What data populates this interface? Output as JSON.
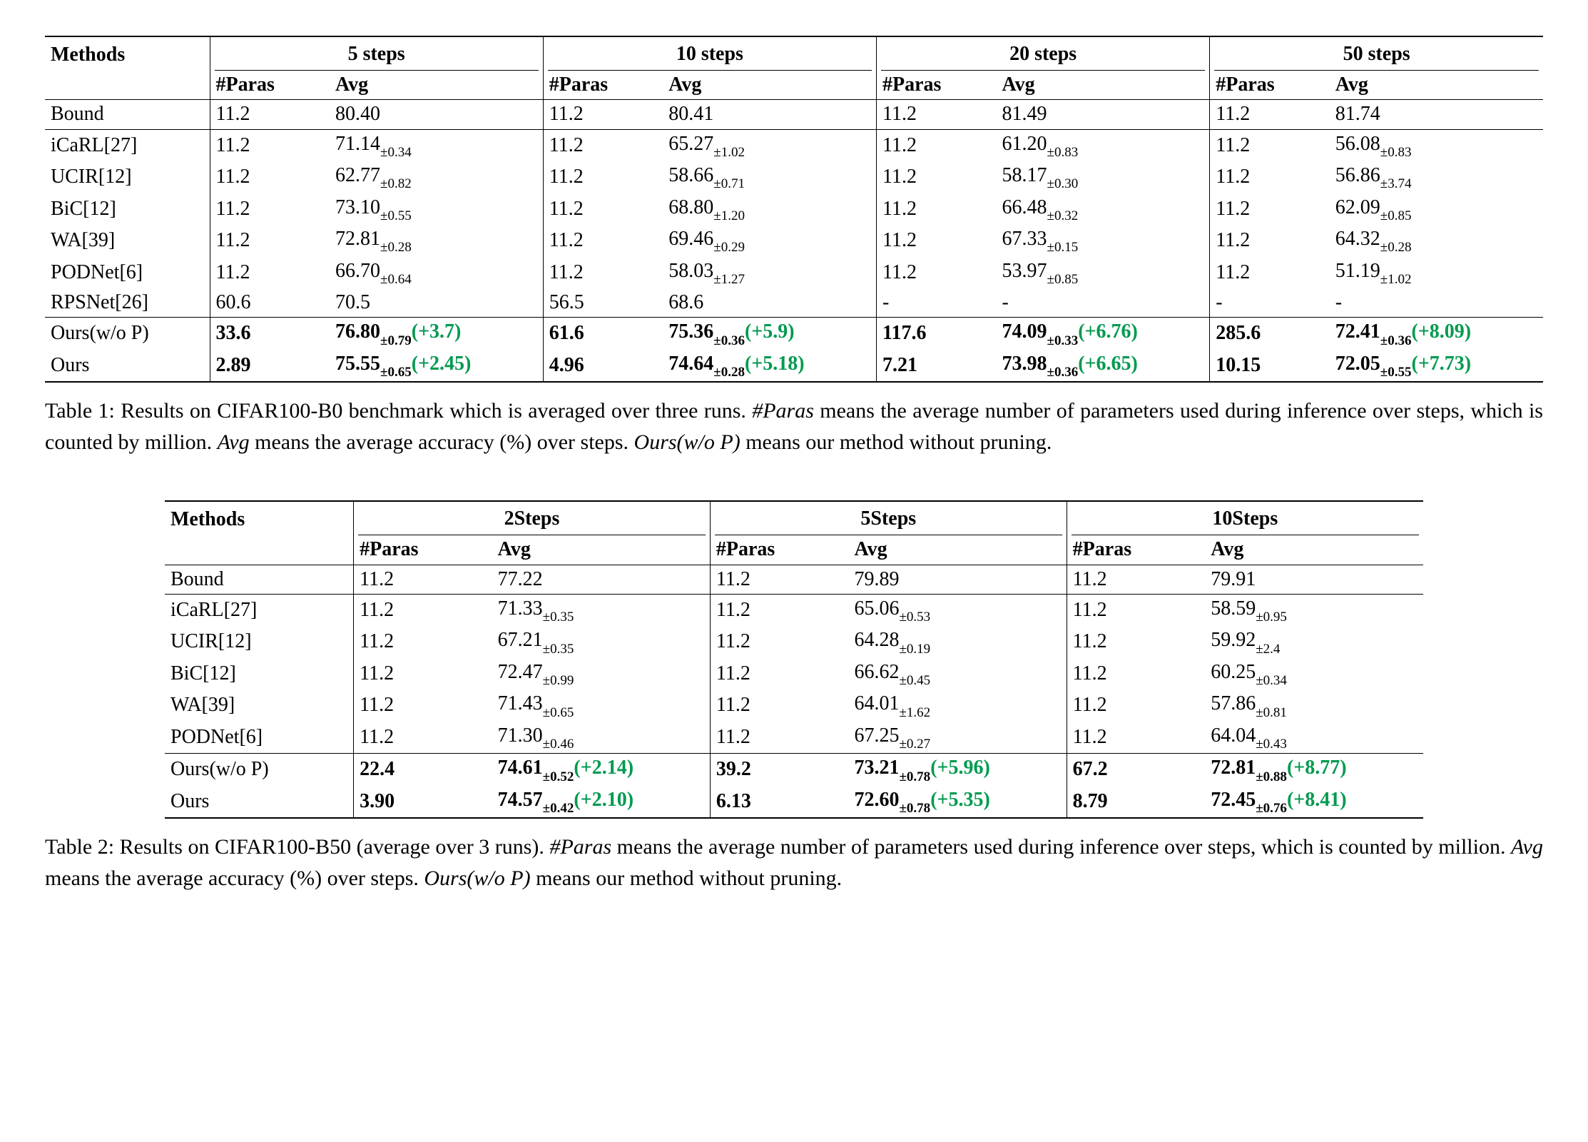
{
  "table1": {
    "headers": {
      "methods": "Methods",
      "steps": [
        "5 steps",
        "10 steps",
        "20 steps",
        "50 steps"
      ],
      "paras": "#Paras",
      "avg": "Avg"
    },
    "caption_prefix": "Table 1: Results on CIFAR100-B0 benchmark which is averaged over three runs. ",
    "caption_paras_label": "#Paras",
    "caption_mid1": " means the average number of parameters used during inference over steps, which is counted by million. ",
    "caption_avg_label": "Avg",
    "caption_mid2": " means the average accuracy (%) over steps. ",
    "caption_ours_label": "Ours(w/o P)",
    "caption_tail": " means our method without pruning.",
    "sections": [
      {
        "rows": [
          {
            "name": "Bound",
            "cells": [
              {
                "paras": "11.2",
                "avg": "80.40"
              },
              {
                "paras": "11.2",
                "avg": "80.41"
              },
              {
                "paras": "11.2",
                "avg": "81.49"
              },
              {
                "paras": "11.2",
                "avg": "81.74"
              }
            ]
          }
        ]
      },
      {
        "rows": [
          {
            "name": "iCaRL[27]",
            "cells": [
              {
                "paras": "11.2",
                "avg": "71.14",
                "pm": "±0.34"
              },
              {
                "paras": "11.2",
                "avg": "65.27",
                "pm": "±1.02"
              },
              {
                "paras": "11.2",
                "avg": "61.20",
                "pm": "±0.83"
              },
              {
                "paras": "11.2",
                "avg": "56.08",
                "pm": "±0.83"
              }
            ]
          },
          {
            "name": "UCIR[12]",
            "cells": [
              {
                "paras": "11.2",
                "avg": "62.77",
                "pm": "±0.82"
              },
              {
                "paras": "11.2",
                "avg": "58.66",
                "pm": "±0.71"
              },
              {
                "paras": "11.2",
                "avg": "58.17",
                "pm": "±0.30"
              },
              {
                "paras": "11.2",
                "avg": "56.86",
                "pm": "±3.74"
              }
            ]
          },
          {
            "name": "BiC[12]",
            "cells": [
              {
                "paras": "11.2",
                "avg": "73.10",
                "pm": "±0.55"
              },
              {
                "paras": "11.2",
                "avg": "68.80",
                "pm": "±1.20"
              },
              {
                "paras": "11.2",
                "avg": "66.48",
                "pm": "±0.32"
              },
              {
                "paras": "11.2",
                "avg": "62.09",
                "pm": "±0.85"
              }
            ]
          },
          {
            "name": "WA[39]",
            "cells": [
              {
                "paras": "11.2",
                "avg": "72.81",
                "pm": "±0.28"
              },
              {
                "paras": "11.2",
                "avg": "69.46",
                "pm": "±0.29"
              },
              {
                "paras": "11.2",
                "avg": "67.33",
                "pm": "±0.15"
              },
              {
                "paras": "11.2",
                "avg": "64.32",
                "pm": "±0.28"
              }
            ]
          },
          {
            "name": "PODNet[6]",
            "cells": [
              {
                "paras": "11.2",
                "avg": "66.70",
                "pm": "±0.64"
              },
              {
                "paras": "11.2",
                "avg": "58.03",
                "pm": "±1.27"
              },
              {
                "paras": "11.2",
                "avg": "53.97",
                "pm": "±0.85"
              },
              {
                "paras": "11.2",
                "avg": "51.19",
                "pm": "±1.02"
              }
            ]
          },
          {
            "name": "RPSNet[26]",
            "cells": [
              {
                "paras": "60.6",
                "avg": "70.5"
              },
              {
                "paras": "56.5",
                "avg": "68.6"
              },
              {
                "paras": "-",
                "avg": "-"
              },
              {
                "paras": "-",
                "avg": "-"
              }
            ]
          }
        ]
      },
      {
        "rows": [
          {
            "name": "Ours(w/o P)",
            "bold": true,
            "cells": [
              {
                "paras": "33.6",
                "avg": "76.80",
                "pm": "±0.79",
                "delta": "(+3.7)"
              },
              {
                "paras": "61.6",
                "avg": "75.36",
                "pm": "±0.36",
                "delta": "(+5.9)"
              },
              {
                "paras": "117.6",
                "avg": "74.09",
                "pm": "±0.33",
                "delta": "(+6.76)"
              },
              {
                "paras": "285.6",
                "avg": "72.41",
                "pm": "±0.36",
                "delta": "(+8.09)"
              }
            ]
          },
          {
            "name": "Ours",
            "bold": true,
            "cells": [
              {
                "paras": "2.89",
                "avg": "75.55",
                "pm": "±0.65",
                "delta": "(+2.45)"
              },
              {
                "paras": "4.96",
                "avg": "74.64",
                "pm": "±0.28",
                "delta": "(+5.18)"
              },
              {
                "paras": "7.21",
                "avg": "73.98",
                "pm": "±0.36",
                "delta": "(+6.65)"
              },
              {
                "paras": "10.15",
                "avg": "72.05",
                "pm": "±0.55",
                "delta": "(+7.73)"
              }
            ]
          }
        ]
      }
    ]
  },
  "table2": {
    "headers": {
      "methods": "Methods",
      "steps": [
        "2Steps",
        "5Steps",
        "10Steps"
      ],
      "paras": "#Paras",
      "avg": "Avg"
    },
    "caption_prefix": "Table 2: Results on CIFAR100-B50 (average over 3 runs). ",
    "caption_paras_label": "#Paras",
    "caption_mid1": " means the average number of parameters used during inference over steps, which is counted by million. ",
    "caption_avg_label": "Avg",
    "caption_mid2": " means the average accuracy (%) over steps. ",
    "caption_ours_label": "Ours(w/o P)",
    "caption_tail": " means our method without pruning.",
    "sections": [
      {
        "rows": [
          {
            "name": "Bound",
            "cells": [
              {
                "paras": "11.2",
                "avg": "77.22"
              },
              {
                "paras": "11.2",
                "avg": "79.89"
              },
              {
                "paras": "11.2",
                "avg": "79.91"
              }
            ]
          }
        ]
      },
      {
        "rows": [
          {
            "name": "iCaRL[27]",
            "cells": [
              {
                "paras": "11.2",
                "avg": "71.33",
                "pm": "±0.35"
              },
              {
                "paras": "11.2",
                "avg": "65.06",
                "pm": "±0.53"
              },
              {
                "paras": "11.2",
                "avg": "58.59",
                "pm": "±0.95"
              }
            ]
          },
          {
            "name": "UCIR[12]",
            "cells": [
              {
                "paras": "11.2",
                "avg": "67.21",
                "pm": "±0.35"
              },
              {
                "paras": "11.2",
                "avg": "64.28",
                "pm": "±0.19"
              },
              {
                "paras": "11.2",
                "avg": "59.92",
                "pm": "±2.4"
              }
            ]
          },
          {
            "name": "BiC[12]",
            "cells": [
              {
                "paras": "11.2",
                "avg": "72.47",
                "pm": "±0.99"
              },
              {
                "paras": "11.2",
                "avg": "66.62",
                "pm": "±0.45"
              },
              {
                "paras": "11.2",
                "avg": "60.25",
                "pm": "±0.34"
              }
            ]
          },
          {
            "name": "WA[39]",
            "cells": [
              {
                "paras": "11.2",
                "avg": "71.43",
                "pm": "±0.65"
              },
              {
                "paras": "11.2",
                "avg": "64.01",
                "pm": "±1.62"
              },
              {
                "paras": "11.2",
                "avg": "57.86",
                "pm": "±0.81"
              }
            ]
          },
          {
            "name": "PODNet[6]",
            "cells": [
              {
                "paras": "11.2",
                "avg": "71.30",
                "pm": "±0.46"
              },
              {
                "paras": "11.2",
                "avg": "67.25",
                "pm": "±0.27"
              },
              {
                "paras": "11.2",
                "avg": "64.04",
                "pm": "±0.43"
              }
            ]
          }
        ]
      },
      {
        "rows": [
          {
            "name": "Ours(w/o P)",
            "bold": true,
            "cells": [
              {
                "paras": "22.4",
                "avg": "74.61",
                "pm": "±0.52",
                "delta": "(+2.14)"
              },
              {
                "paras": "39.2",
                "avg": "73.21",
                "pm": "±0.78",
                "delta": "(+5.96)"
              },
              {
                "paras": "67.2",
                "avg": "72.81",
                "pm": "±0.88",
                "delta": "(+8.77)"
              }
            ]
          },
          {
            "name": "Ours",
            "bold": true,
            "cells": [
              {
                "paras": "3.90",
                "avg": "74.57",
                "pm": "±0.42",
                "delta": "(+2.10)"
              },
              {
                "paras": "6.13",
                "avg": "72.60",
                "pm": "±0.78",
                "delta": "(+5.35)"
              },
              {
                "paras": "8.79",
                "avg": "72.45",
                "pm": "±0.76",
                "delta": "(+8.41)"
              }
            ]
          }
        ]
      }
    ]
  }
}
